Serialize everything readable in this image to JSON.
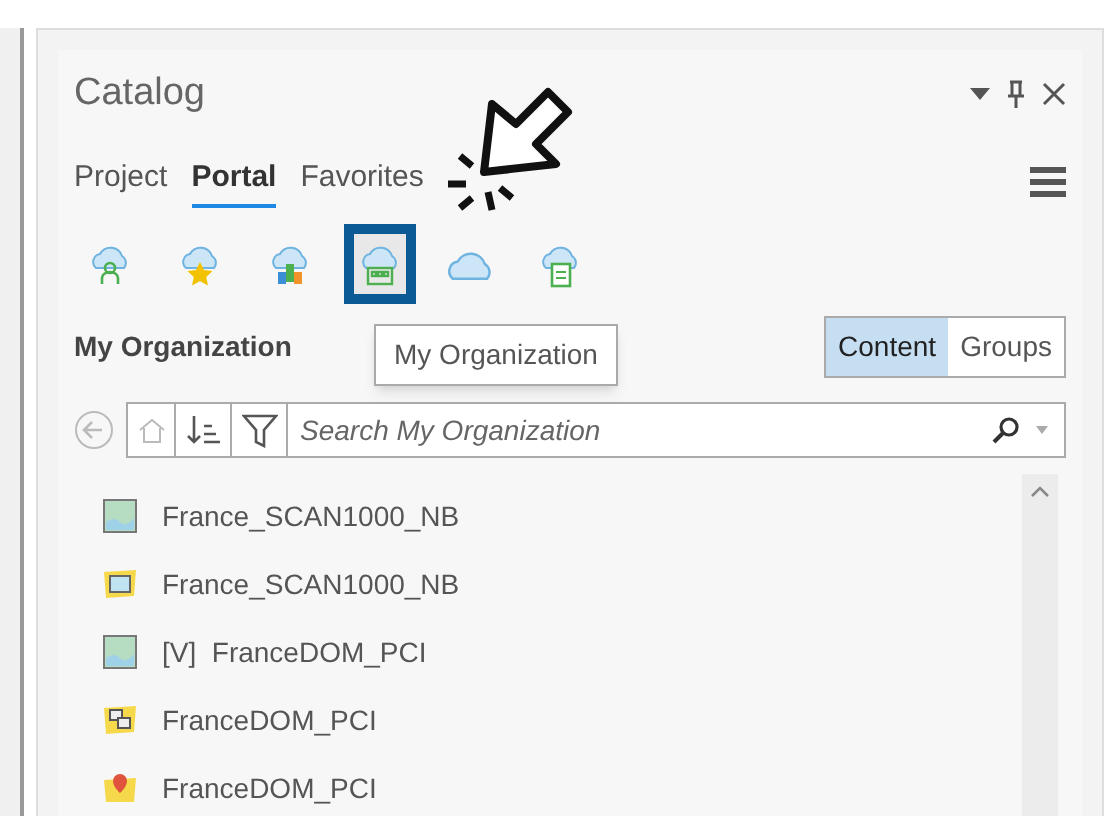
{
  "pane": {
    "title": "Catalog"
  },
  "tabs": [
    {
      "label": "Project",
      "selected": false
    },
    {
      "label": "Portal",
      "selected": true
    },
    {
      "label": "Favorites",
      "selected": false
    }
  ],
  "portal_buttons": [
    {
      "kind": "user",
      "selected": false
    },
    {
      "kind": "star",
      "selected": false
    },
    {
      "kind": "group",
      "selected": false
    },
    {
      "kind": "organization",
      "selected": true
    },
    {
      "kind": "cloud",
      "selected": false
    },
    {
      "kind": "document",
      "selected": false
    }
  ],
  "tooltip": "My Organization",
  "section_title": "My Organization",
  "view_toggle": [
    {
      "label": "Content",
      "selected": true
    },
    {
      "label": "Groups",
      "selected": false
    }
  ],
  "search": {
    "placeholder": "Search My Organization"
  },
  "items": [
    {
      "kind": "imagery",
      "label": "France_SCAN1000_NB"
    },
    {
      "kind": "map",
      "label": "France_SCAN1000_NB"
    },
    {
      "kind": "imagery",
      "label": "[V]  FranceDOM_PCI"
    },
    {
      "kind": "tiles",
      "label": "FranceDOM_PCI"
    },
    {
      "kind": "marker",
      "label": "FranceDOM_PCI"
    }
  ]
}
